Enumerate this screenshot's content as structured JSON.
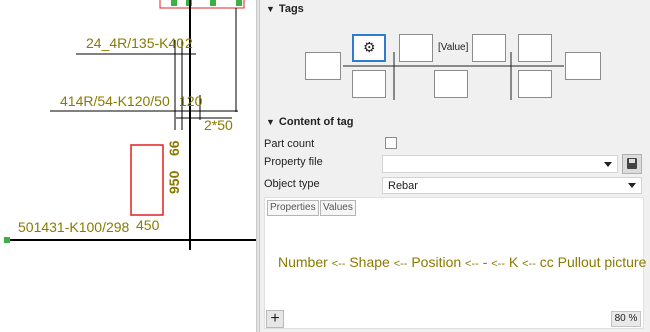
{
  "drawing": {
    "labels": {
      "bar1": "24_4R/135-K40",
      "bar1_qty": "2",
      "bar2": "414R/54-K120/50",
      "dim120": "120",
      "spacing": "2*50",
      "dim66": "66",
      "dim950": "950",
      "dim450": "450",
      "bar3": "501431-K100/298"
    }
  },
  "tags": {
    "header": "Tags",
    "value_placeholder": "[Value]"
  },
  "content": {
    "header": "Content of tag",
    "part_count_label": "Part count",
    "property_file_label": "Property file",
    "property_file_value": "",
    "object_type_label": "Object type",
    "object_type_value": "Rebar",
    "tabs": [
      "Properties",
      "Values"
    ],
    "pullout_items": [
      "Number",
      "<--",
      "Shape",
      "<--",
      "Position",
      "<--",
      "-",
      "<--",
      "K",
      "<--",
      "cc",
      "Pullout picture"
    ],
    "zoom": "80 %",
    "add_symbol": "+"
  },
  "colors": {
    "dim_text": "#8a7a00",
    "rebar_red": "#e02020",
    "handle_green": "#3cb043",
    "gear_border": "#2e7bd6"
  }
}
